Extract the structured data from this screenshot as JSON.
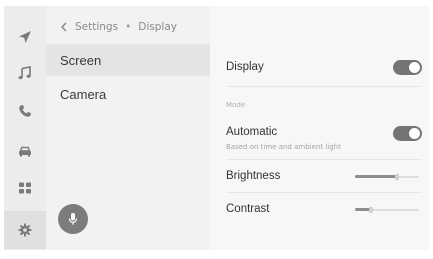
{
  "breadcrumb": {
    "parent": "Settings",
    "separator": "•",
    "current": "Display"
  },
  "menu": [
    {
      "label": "Screen",
      "selected": true
    },
    {
      "label": "Camera",
      "selected": false
    }
  ],
  "rail": [
    {
      "icon": "navigation-icon"
    },
    {
      "icon": "music-icon"
    },
    {
      "icon": "phone-icon"
    },
    {
      "icon": "car-icon"
    },
    {
      "icon": "apps-icon"
    },
    {
      "icon": "settings-icon",
      "active": true
    }
  ],
  "voice": {
    "icon": "microphone-icon"
  },
  "detail": {
    "display": {
      "label": "Display",
      "on": true
    },
    "mode_section": "Mode",
    "automatic": {
      "label": "Automatic",
      "sub": "Based on time and ambient light",
      "on": true
    },
    "brightness": {
      "label": "Brightness",
      "level": 0.65
    },
    "contrast": {
      "label": "Contrast",
      "level": 0.25
    }
  },
  "colors": {
    "accent": "#747474",
    "panel": "#f7f7f7",
    "list": "#f2f2f2",
    "rail": "#ececec"
  }
}
